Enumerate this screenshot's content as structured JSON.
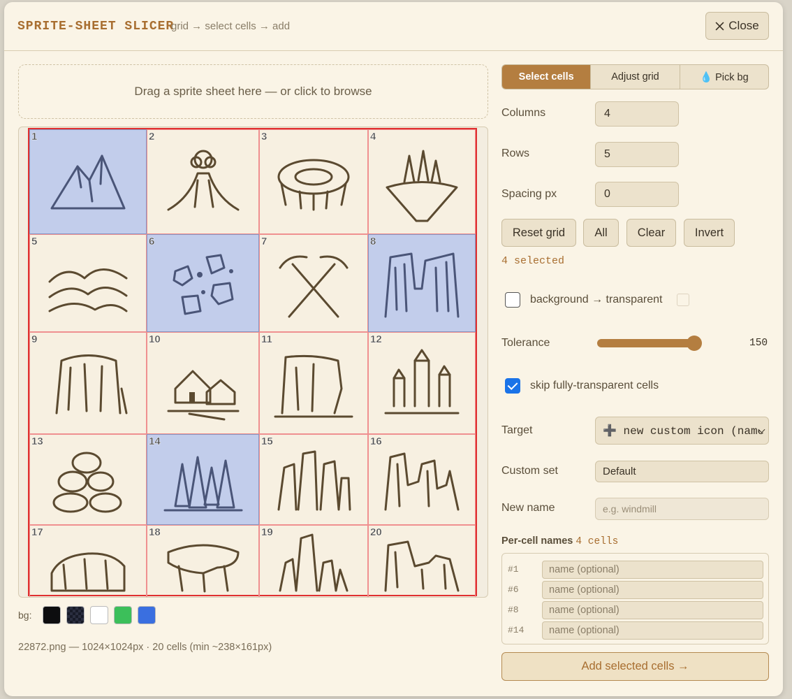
{
  "header": {
    "title": "SPRITE-SHEET SLICER",
    "subtitle": "grid → select cells → add",
    "close_label": "Close"
  },
  "dropzone": {
    "text": "Drag a sprite sheet here — or click to browse"
  },
  "sheet": {
    "columns": 4,
    "rows": 5,
    "selected_cells": [
      1,
      6,
      8,
      14
    ],
    "cells": [
      {
        "n": "1",
        "icon": "mountains-icon"
      },
      {
        "n": "2",
        "icon": "volcano-icon"
      },
      {
        "n": "3",
        "icon": "crater-icon"
      },
      {
        "n": "4",
        "icon": "floating-island-icon"
      },
      {
        "n": "5",
        "icon": "hills-icon"
      },
      {
        "n": "6",
        "icon": "boulders-icon"
      },
      {
        "n": "7",
        "icon": "crossed-pickaxes-icon"
      },
      {
        "n": "8",
        "icon": "canyon-icon"
      },
      {
        "n": "9",
        "icon": "mesa-icon"
      },
      {
        "n": "10",
        "icon": "village-icon"
      },
      {
        "n": "11",
        "icon": "cliff-icon"
      },
      {
        "n": "12",
        "icon": "castle-icon"
      },
      {
        "n": "13",
        "icon": "rock-pile-icon"
      },
      {
        "n": "14",
        "icon": "pine-forest-icon"
      },
      {
        "n": "15",
        "icon": "rock-spires-icon"
      },
      {
        "n": "16",
        "icon": "rock-formation-icon"
      },
      {
        "n": "17",
        "icon": "plateau-icon"
      },
      {
        "n": "18",
        "icon": "rock-ledge-icon"
      },
      {
        "n": "19",
        "icon": "crags-icon"
      },
      {
        "n": "20",
        "icon": "ridge-icon"
      }
    ]
  },
  "bg_picker": {
    "label": "bg:",
    "swatches": [
      "#0d0d0f",
      "#1e2233",
      "#ffffff",
      "#3cbf5a",
      "#3a6fe0"
    ]
  },
  "file_info": "22872.png — 1024×1024px · 20 cells (min ~238×161px)",
  "tabs": [
    {
      "label": "Select cells",
      "active": true
    },
    {
      "label": "Adjust grid",
      "active": false
    },
    {
      "label": "💧 Pick bg",
      "active": false
    }
  ],
  "fields": {
    "columns_label": "Columns",
    "columns_value": "4",
    "rows_label": "Rows",
    "rows_value": "5",
    "spacing_label": "Spacing px",
    "spacing_value": "0"
  },
  "buttons": {
    "reset": "Reset grid",
    "all": "All",
    "clear": "Clear",
    "invert": "Invert"
  },
  "selected_count": "4 selected",
  "bg_transparent": {
    "label": "background → transparent",
    "checked": false
  },
  "tolerance": {
    "label": "Tolerance",
    "value": "150",
    "fraction": 0.96
  },
  "skip_transparent": {
    "label": "skip fully-transparent cells",
    "checked": true
  },
  "target": {
    "label": "Target",
    "value": "➕ new custom icon (name"
  },
  "custom_set": {
    "label": "Custom set",
    "value": "Default"
  },
  "new_name": {
    "label": "New name",
    "placeholder": "e.g. windmill"
  },
  "per_cell": {
    "heading": "Per-cell names",
    "count": "4 cells",
    "rows": [
      {
        "id": "#1",
        "placeholder": "name (optional)"
      },
      {
        "id": "#6",
        "placeholder": "name (optional)"
      },
      {
        "id": "#8",
        "placeholder": "name (optional)"
      },
      {
        "id": "#14",
        "placeholder": "name (optional)"
      }
    ]
  },
  "add_button": "Add selected cells →",
  "colors": {
    "accent": "#b47e40",
    "grid_line": "#e03030",
    "selection": "#c2cdeb"
  }
}
